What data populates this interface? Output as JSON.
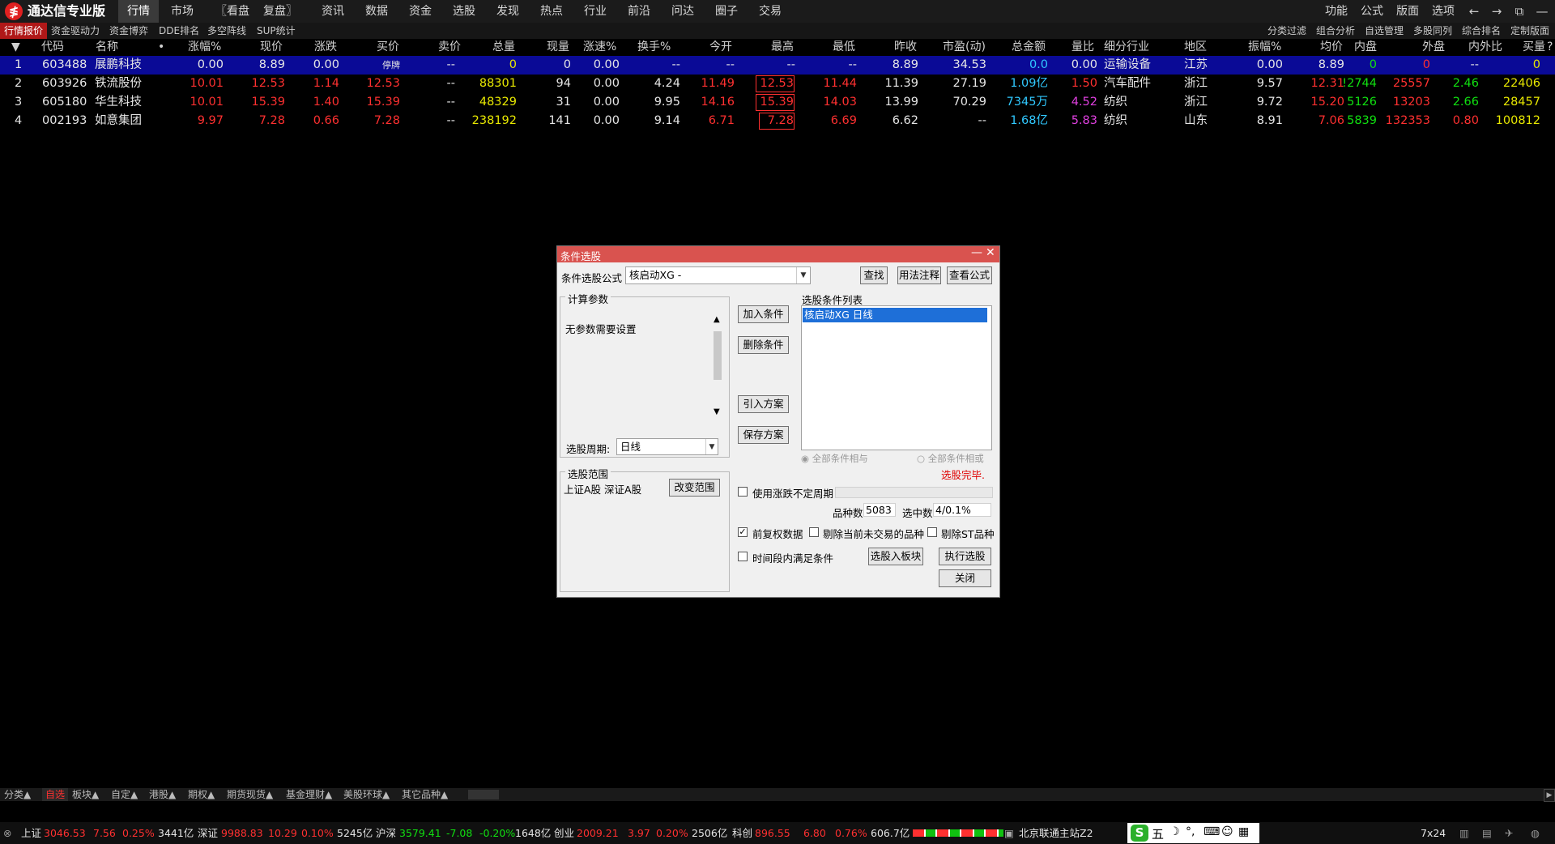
{
  "app": {
    "title": "通达信专业版",
    "logo_glyph": "≸"
  },
  "menu": {
    "items": [
      "行情",
      "市场",
      "〖看盘",
      "复盘〗",
      "资讯",
      "数据",
      "资金",
      "选股",
      "发现",
      "热点",
      "行业",
      "前沿",
      "问达",
      "圈子",
      "交易"
    ],
    "right": [
      "功能",
      "公式",
      "版面",
      "选项"
    ],
    "window_buttons": [
      "←",
      "→",
      "⧉",
      "—",
      "☐",
      "✕"
    ]
  },
  "subtabs": {
    "left": [
      "行情报价",
      "资金驱动力",
      "资金博弈",
      "DDE排名",
      "多空阵线",
      "SUP统计"
    ],
    "right": [
      "分类过滤",
      "组合分析",
      "自选管理",
      "多股同列",
      "综合排名",
      "定制版面"
    ]
  },
  "table": {
    "sort_icon": "▼",
    "dot": "•",
    "corner": "?",
    "columns": [
      "代码",
      "名称",
      "涨幅%",
      "现价",
      "涨跌",
      "买价",
      "卖价",
      "总量",
      "现量",
      "涨速%",
      "换手%",
      "今开",
      "最高",
      "最低",
      "昨收",
      "市盈(动)",
      "总金额",
      "量比",
      "细分行业",
      "地区",
      "振幅%",
      "均价",
      "内盘",
      "外盘",
      "内外比",
      "买量"
    ],
    "rows": [
      {
        "idx": "1",
        "code": "603488",
        "name": "展鹏科技",
        "chg_pct": "0.00",
        "price": "8.89",
        "chg": "0.00",
        "bid": "停牌",
        "ask": "--",
        "vol": "0",
        "cur_vol": "0",
        "speed": "0.00",
        "turnover": "--",
        "open": "--",
        "high": "--",
        "low": "--",
        "prev": "8.89",
        "pe": "34.53",
        "amount": "0.0",
        "vol_ratio": "0.00",
        "industry": "运输设备",
        "region": "江苏",
        "amp": "0.00",
        "avg": "8.89",
        "inner": "0",
        "outer": "0",
        "io_ratio": "--",
        "bid_vol": "0"
      },
      {
        "idx": "2",
        "code": "603926",
        "name": "铁流股份",
        "chg_pct": "10.01",
        "price": "12.53",
        "chg": "1.14",
        "bid": "12.53",
        "ask": "--",
        "vol": "88301",
        "cur_vol": "94",
        "speed": "0.00",
        "turnover": "4.24",
        "open": "11.49",
        "high": "12.53",
        "low": "11.44",
        "prev": "11.39",
        "pe": "27.19",
        "amount": "1.09亿",
        "vol_ratio": "1.50",
        "industry": "汽车配件",
        "region": "浙江",
        "amp": "9.57",
        "avg": "12.31",
        "inner": "!2744",
        "outer": "25557",
        "io_ratio": "2.46",
        "bid_vol": "22406"
      },
      {
        "idx": "3",
        "code": "605180",
        "name": "华生科技",
        "chg_pct": "10.01",
        "price": "15.39",
        "chg": "1.40",
        "bid": "15.39",
        "ask": "--",
        "vol": "48329",
        "cur_vol": "31",
        "speed": "0.00",
        "turnover": "9.95",
        "open": "14.16",
        "high": "15.39",
        "low": "14.03",
        "prev": "13.99",
        "pe": "70.29",
        "amount": "7345万",
        "vol_ratio": "4.52",
        "industry": "纺织",
        "region": "浙江",
        "amp": "9.72",
        "avg": "15.20",
        "inner": "5126",
        "outer": "13203",
        "io_ratio": "2.66",
        "bid_vol": "28457"
      },
      {
        "idx": "4",
        "code": "002193",
        "name": "如意集团",
        "chg_pct": "9.97",
        "price": "7.28",
        "chg": "0.66",
        "bid": "7.28",
        "ask": "--",
        "vol": "238192",
        "cur_vol": "141",
        "speed": "0.00",
        "turnover": "9.14",
        "open": "6.71",
        "high": "7.28",
        "low": "6.69",
        "prev": "6.62",
        "pe": "--",
        "amount": "1.68亿",
        "vol_ratio": "5.83",
        "industry": "纺织",
        "region": "山东",
        "amp": "8.91",
        "avg": "7.06",
        "inner": "5839",
        "outer": "132353",
        "io_ratio": "0.80",
        "bid_vol": "100812"
      }
    ]
  },
  "dialog": {
    "title": "条件选股",
    "formula_label": "条件选股公式",
    "formula_value": "核启动XG    -",
    "find": "查找",
    "usage": "用法注释",
    "view_formula": "查看公式",
    "params_group": "计算参数",
    "params_text": "无参数需要设置",
    "period_label": "选股周期:",
    "period_value": "日线",
    "add_cond": "加入条件",
    "del_cond": "删除条件",
    "import_plan": "引入方案",
    "save_plan": "保存方案",
    "cond_list_label": "选股条件列表",
    "cond_item": "核启动XG  日线",
    "radio_and": "全部条件相与",
    "radio_or": "全部条件相或",
    "done": "选股完毕.",
    "range_group": "选股范围",
    "range_text": "上证A股 深证A股",
    "change_range": "改变范围",
    "use_period": "使用涨跌不定周期",
    "count_label": "品种数",
    "count_value": "5083",
    "hit_label": "选中数",
    "hit_value": "4/0.1%",
    "fq_label": "前复权数据",
    "fq_checked": true,
    "del_notrade": "剔除当前未交易的品种",
    "del_st": "剔除ST品种",
    "time_cond": "时间段内满足条件",
    "to_block": "选股入板块",
    "run": "执行选股",
    "close": "关闭"
  },
  "bottom_tabs": [
    "分类▲",
    "自选",
    "板块▲",
    "自定▲",
    "港股▲",
    "期权▲",
    "期货现货▲",
    "基金理财▲",
    "美股环球▲",
    "其它品种▲"
  ],
  "status": {
    "sh_label": "上证",
    "sh_val": "3046.53",
    "sh_chg": "7.56",
    "sh_pct": "0.25%",
    "sh_amt": "3441亿",
    "sz_label": "深证",
    "sz_val": "9988.83",
    "sz_chg": "10.29",
    "sz_pct": "0.10%",
    "sz_amt": "5245亿",
    "hs_label": "沪深",
    "hs_val": "3579.41",
    "hs_chg": "-7.08",
    "hs_pct": "-0.20%",
    "hs_amt": "1648亿",
    "cy_label": "创业",
    "cy_val": "2009.21",
    "cy_chg": "3.97",
    "cy_pct": "0.20%",
    "cy_amt": "2506亿",
    "kc_label": "科创",
    "kc_val": "896.55",
    "kc_chg": "6.80",
    "kc_pct": "0.76%",
    "kc_amt": "606.7亿",
    "server": "北京联通主站Z2",
    "ime": "五",
    "clock": "7x24"
  }
}
